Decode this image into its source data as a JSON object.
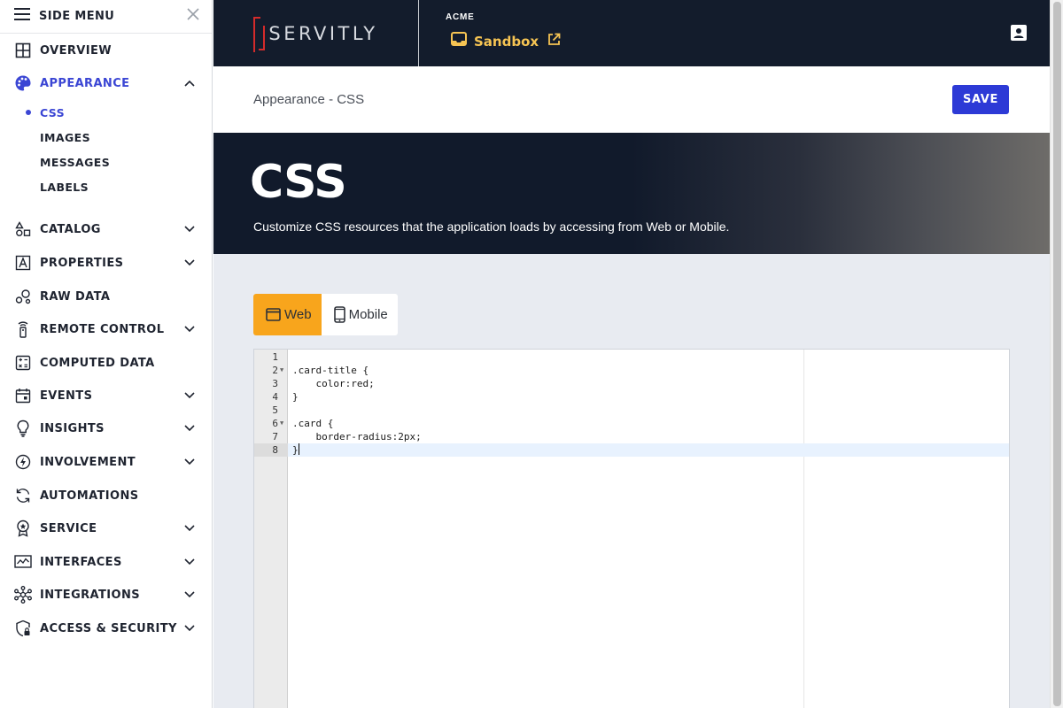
{
  "sidebar": {
    "title": "SIDE MENU",
    "items": [
      {
        "label": "OVERVIEW"
      },
      {
        "label": "APPEARANCE"
      },
      {
        "label": "CATALOG"
      },
      {
        "label": "PROPERTIES"
      },
      {
        "label": "RAW DATA"
      },
      {
        "label": "REMOTE CONTROL"
      },
      {
        "label": "COMPUTED DATA"
      },
      {
        "label": "EVENTS"
      },
      {
        "label": "INSIGHTS"
      },
      {
        "label": "INVOLVEMENT"
      },
      {
        "label": "AUTOMATIONS"
      },
      {
        "label": "SERVICE"
      },
      {
        "label": "INTERFACES"
      },
      {
        "label": "INTEGRATIONS"
      },
      {
        "label": "ACCESS & SECURITY"
      }
    ],
    "appearance_sub": [
      {
        "label": "CSS"
      },
      {
        "label": "IMAGES"
      },
      {
        "label": "MESSAGES"
      },
      {
        "label": "LABELS"
      }
    ]
  },
  "topbar": {
    "brand": "SERVITLY",
    "tenant": "ACME",
    "app": "Sandbox"
  },
  "page": {
    "breadcrumb": "Appearance - CSS",
    "save_label": "SAVE",
    "hero_title": "CSS",
    "hero_subtitle": "Customize CSS resources that the application loads by accessing from Web or Mobile."
  },
  "tabs": [
    {
      "label": "Web"
    },
    {
      "label": "Mobile"
    }
  ],
  "editor": {
    "lines": [
      {
        "n": "1",
        "code": ""
      },
      {
        "n": "2",
        "code": ".card-title {"
      },
      {
        "n": "3",
        "code": "    color:red;"
      },
      {
        "n": "4",
        "code": "}"
      },
      {
        "n": "5",
        "code": ""
      },
      {
        "n": "6",
        "code": ".card {"
      },
      {
        "n": "7",
        "code": "    border-radius:2px;"
      },
      {
        "n": "8",
        "code": "}"
      }
    ]
  },
  "colors": {
    "accent": "#3b46d4",
    "save_button": "#2d3ad6",
    "active_tab": "#f8a51c",
    "topbar": "#131c2c",
    "app_name": "#f6c453"
  }
}
